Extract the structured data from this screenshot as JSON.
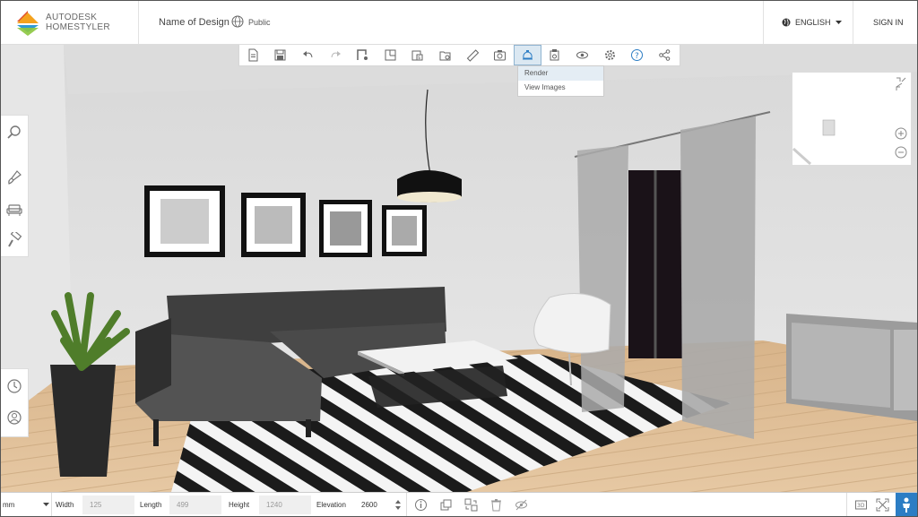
{
  "brand": {
    "line1": "AUTODESK",
    "line2": "HOMESTYLER",
    "colors": [
      "#f4a21d",
      "#2e9ad6",
      "#8cc63f",
      "#e04f2b"
    ]
  },
  "header": {
    "design_name": "Name of Design",
    "visibility": "Public",
    "language": "ENGLISH",
    "sign_in": "SIGN IN"
  },
  "toolbar": {
    "icons": [
      "new-file-icon",
      "save-icon",
      "undo-icon",
      "redo-icon",
      "draw-wall-icon",
      "draw-room-icon",
      "import-floorplan-icon",
      "open-folder-icon",
      "measure-icon",
      "snapshot-icon",
      "render-icon",
      "export-icon",
      "view-icon",
      "settings-icon",
      "help-icon",
      "share-icon"
    ],
    "active_index": 10,
    "accent": "#2c7dc4"
  },
  "render_menu": {
    "items": [
      "Render",
      "View Images"
    ]
  },
  "left_sidebar": {
    "icons": [
      "search-icon",
      "paint-icon",
      "furniture-icon",
      "roller-icon"
    ]
  },
  "left_sidebar_bottom": {
    "icons": [
      "compass-icon",
      "user-icon"
    ]
  },
  "bottom_bar": {
    "unit": "mm",
    "width_label": "Width",
    "width_value": "125",
    "length_label": "Length",
    "length_value": "499",
    "height_label": "Height",
    "height_value": "1240",
    "elevation_label": "Elevation",
    "elevation_value": "2600",
    "icons": [
      "info-icon",
      "duplicate-icon",
      "replace-icon",
      "delete-icon",
      "hide-icon"
    ],
    "right_icons": [
      "3d-view-icon",
      "fullscreen-icon",
      "walk-mode-icon"
    ]
  }
}
